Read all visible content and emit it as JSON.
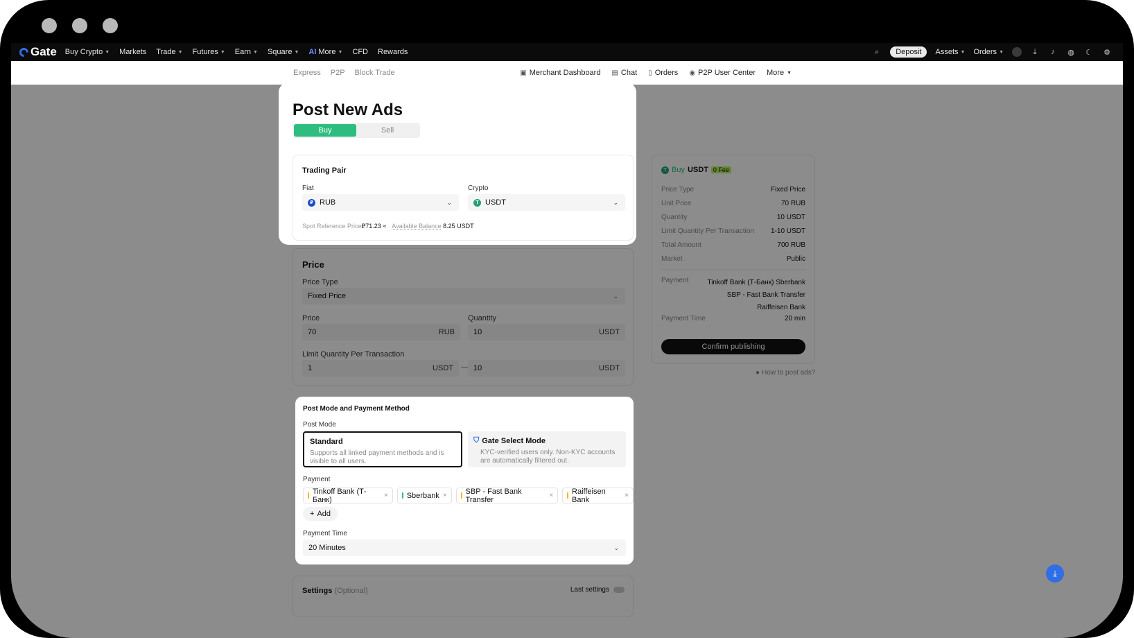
{
  "nav": {
    "logo": "Gate",
    "items": [
      {
        "label": "Buy Crypto",
        "caret": true
      },
      {
        "label": "Markets",
        "caret": false
      },
      {
        "label": "Trade",
        "caret": true
      },
      {
        "label": "Futures",
        "caret": true
      },
      {
        "label": "Earn",
        "caret": true
      },
      {
        "label": "Square",
        "caret": true
      }
    ],
    "ai_badge": "AI",
    "more": "More",
    "cfd": "CFD",
    "rewards": "Rewards",
    "deposit": "Deposit",
    "assets": "Assets",
    "orders": "Orders"
  },
  "subnav": {
    "express": "Express",
    "p2p": "P2P",
    "block_trade": "Block Trade",
    "merchant_dashboard": "Merchant Dashboard",
    "chat": "Chat",
    "orders": "Orders",
    "user_center": "P2P User Center",
    "more": "More"
  },
  "form": {
    "title": "Post New Ads",
    "tab_buy": "Buy",
    "tab_sell": "Sell",
    "trading_pair": {
      "title": "Trading Pair",
      "fiat_label": "Fiat",
      "fiat_value": "RUB",
      "crypto_label": "Crypto",
      "crypto_value": "USDT",
      "spot_ref_label": "Spot Reference Price",
      "spot_ref_value": "₽71.23 ≈",
      "balance_label": "Available Balance",
      "balance_value": "8.25 USDT"
    },
    "price": {
      "title": "Price",
      "price_type_label": "Price Type",
      "price_type_value": "Fixed Price",
      "price_label": "Price",
      "price_value": "70",
      "price_unit": "RUB",
      "quantity_label": "Quantity",
      "quantity_value": "10",
      "quantity_unit": "USDT",
      "limit_label": "Limit Quantity Per Transaction",
      "limit_min": "1",
      "limit_min_unit": "USDT",
      "limit_sep": "—",
      "limit_max": "10",
      "limit_max_unit": "USDT"
    },
    "post_mode": {
      "title": "Post Mode and Payment Method",
      "mode_label": "Post Mode",
      "standard_title": "Standard",
      "standard_desc": "Supports all linked payment methods and is visible to all users.",
      "select_title": "Gate Select Mode",
      "select_desc": "KYC-verified users only. Non-KYC accounts are automatically filtered out.",
      "payment_label": "Payment",
      "payments": [
        {
          "label": "Tinkoff Bank (Т-Банк)",
          "color": "#f5b800"
        },
        {
          "label": "Sberbank",
          "color": "#2dbd7f"
        },
        {
          "label": "SBP - Fast Bank Transfer",
          "color": "#f5b800"
        },
        {
          "label": "Raiffeisen Bank",
          "color": "#f5b800"
        }
      ],
      "add_label": "Add",
      "payment_time_label": "Payment Time",
      "payment_time_value": "20 Minutes"
    },
    "settings": {
      "title": "Settings",
      "optional": "(Optional)",
      "last_settings": "Last settings"
    }
  },
  "summary": {
    "buy": "Buy",
    "coin": "USDT",
    "fee_badge": "0 Fee",
    "rows": [
      {
        "k": "Price Type",
        "v": "Fixed Price"
      },
      {
        "k": "Unit Price",
        "v": "70 RUB"
      },
      {
        "k": "Quantity",
        "v": "10 USDT"
      },
      {
        "k": "Limit Quantity Per Transaction",
        "v": "1-10 USDT"
      },
      {
        "k": "Total Amount",
        "v": "700 RUB"
      },
      {
        "k": "Market",
        "v": "Public"
      }
    ],
    "payment_label": "Payment",
    "payment_values": [
      "Tinkoff Bank (Т-Банк)",
      "Sberbank",
      "SBP - Fast Bank Transfer",
      "Raiffeisen Bank"
    ],
    "payment_time_label": "Payment Time",
    "payment_time_value": "20 min",
    "confirm": "Confirm publishing",
    "how_to": "How to post ads?"
  },
  "colors": {
    "accent_green": "#2dbd7f",
    "brand_blue": "#2f6ee5",
    "rub_blue": "#1a4fc9",
    "usdt_green": "#26a17b",
    "fee_badge": "#b6f35b"
  }
}
